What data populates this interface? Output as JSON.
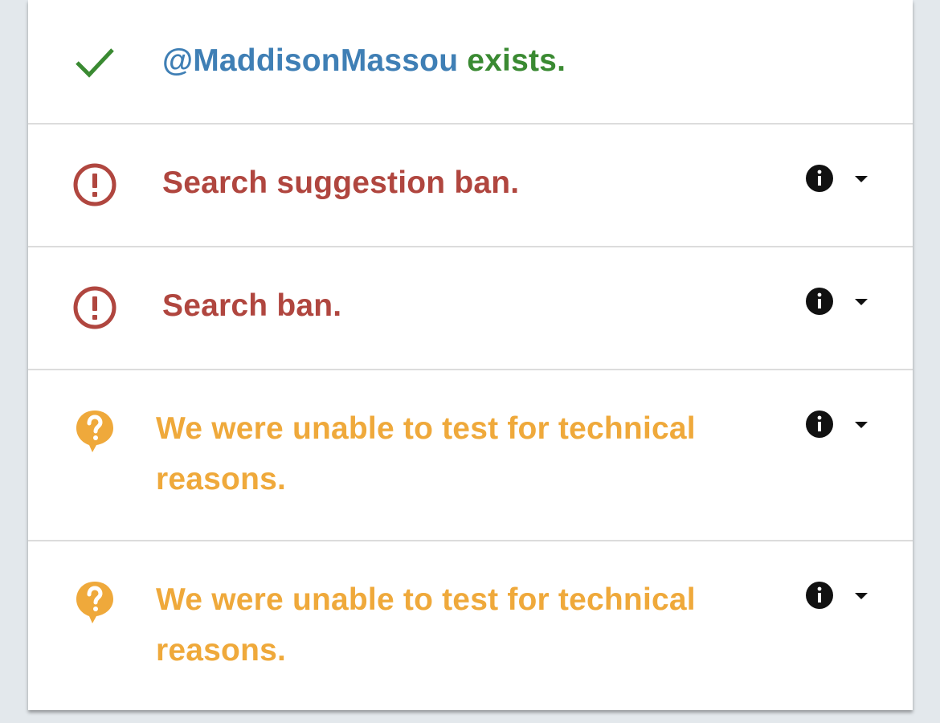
{
  "rows": [
    {
      "status": "exists",
      "icon": "check-icon",
      "handle": "@MaddisonMassou",
      "text": "exists.",
      "color": "#3a8a32",
      "handle_color": "#3f7fb5"
    },
    {
      "status": "banned",
      "icon": "exclamation-circle-icon",
      "text": "Search suggestion ban.",
      "color": "#b0463f",
      "has_info": true
    },
    {
      "status": "banned",
      "icon": "exclamation-circle-icon",
      "text": "Search ban.",
      "color": "#b0463f",
      "has_info": true
    },
    {
      "status": "unknown",
      "icon": "question-bubble-icon",
      "line1": "We were unable to test for technical",
      "line2": "reasons.",
      "color": "#efa93b",
      "has_info": true
    },
    {
      "status": "unknown",
      "icon": "question-bubble-icon",
      "line1": "We were unable to test for technical",
      "line2": "reasons.",
      "color": "#efa93b",
      "has_info": true
    }
  ],
  "colors": {
    "page_bg": "#e3e8ec",
    "card_bg": "#ffffff",
    "divider": "#dcdcdc"
  }
}
